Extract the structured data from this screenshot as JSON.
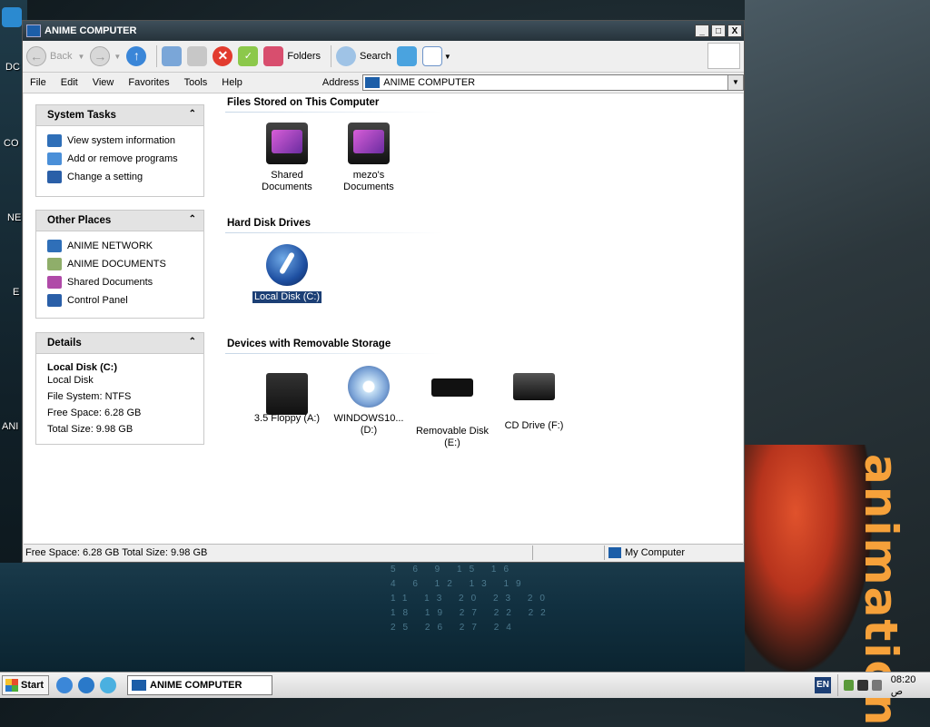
{
  "window": {
    "title": "ANIME COMPUTER",
    "controls": {
      "minimize": "_",
      "maximize": "□",
      "close": "X"
    }
  },
  "toolbar": {
    "back_label": "Back",
    "folders_label": "Folders",
    "search_label": "Search"
  },
  "menubar": {
    "items": [
      "File",
      "Edit",
      "View",
      "Favorites",
      "Tools",
      "Help"
    ]
  },
  "address": {
    "label": "Address",
    "value": "ANIME COMPUTER"
  },
  "left_pane": {
    "system_tasks": {
      "title": "System Tasks",
      "items": [
        "View system information",
        "Add or remove programs",
        "Change a setting"
      ]
    },
    "other_places": {
      "title": "Other Places",
      "items": [
        "ANIME NETWORK",
        "ANIME DOCUMENTS",
        "Shared Documents",
        "Control Panel"
      ]
    },
    "details": {
      "title": "Details",
      "name": "Local Disk (C:)",
      "type": "Local Disk",
      "file_system": "File System: NTFS",
      "free_space": "Free Space: 6.28 GB",
      "total_size": "Total Size: 9.98 GB"
    }
  },
  "main": {
    "groups": [
      {
        "title": "Files Stored on This Computer"
      },
      {
        "title": "Hard Disk Drives"
      },
      {
        "title": "Devices with Removable Storage"
      }
    ],
    "files": [
      {
        "line1": "Shared",
        "line2": "Documents"
      },
      {
        "line1": "mezo's",
        "line2": "Documents"
      }
    ],
    "hard_disks": [
      {
        "label": "Local Disk (C:)",
        "selected": true
      }
    ],
    "removable": [
      {
        "line1": "3.5 Floppy (A:)",
        "line2": ""
      },
      {
        "line1": "WINDOWS10...",
        "line2": "(D:)"
      },
      {
        "line1": "Removable Disk",
        "line2": "(E:)"
      },
      {
        "line1": "CD Drive (F:)",
        "line2": ""
      }
    ]
  },
  "statusbar": {
    "left": "Free Space: 6.28 GB Total Size: 9.98 GB",
    "zone": "My Computer"
  },
  "taskbar": {
    "start_label": "Start",
    "task_label": "ANIME COMPUTER",
    "lang": "EN",
    "clock": "08:20 ص"
  },
  "desktop": {
    "wallpaper_text": "animation",
    "labels": [
      "DC",
      "CO",
      "NE",
      "E",
      "ANI"
    ]
  },
  "colors": {
    "titlebar": "#26333b",
    "selection": "#1c3f75",
    "accent_orange": "#f6a13a"
  }
}
